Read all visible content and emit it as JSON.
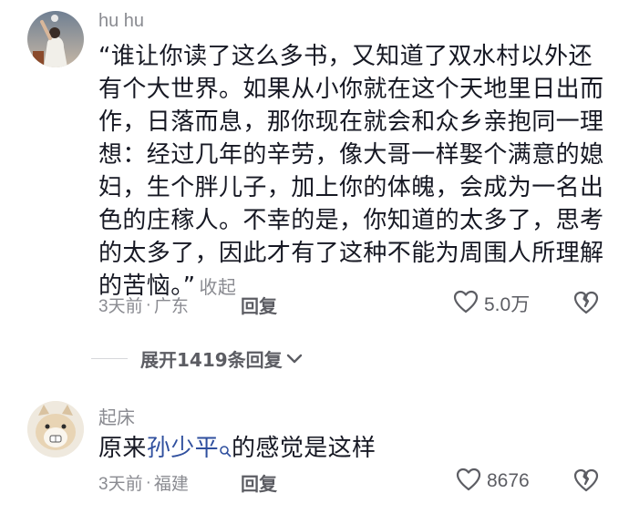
{
  "comment1": {
    "username": "hu hu",
    "text": "“谁让你读了这么多书，又知道了双水村以外还有个大世界。如果从小你就在这个天地里日出而作，日落而息，那你现在就会和众乡亲抱同一理想：经过几年的辛劳，像大哥一样娶个满意的媳妇，生个胖儿子，加上你的体魄，会成为一名出色的庄稼人。不幸的是，你知道的太多了，思考的太多了，因此才有了这种不能为周围人所理解的苦恼。”",
    "fold_label": "收起",
    "time": "3天前",
    "separator": "·",
    "location": "广东",
    "reply_label": "回复",
    "likes": "5.0万"
  },
  "expand": {
    "label": "展开1419条回复"
  },
  "comment2": {
    "username": "起床",
    "text_before": "原来",
    "mention": "孙少平",
    "text_after": "的感觉是这样",
    "time": "3天前",
    "separator": "·",
    "location": "福建",
    "reply_label": "回复",
    "likes": "8676"
  },
  "colors": {
    "meta_gray": "#8a8b91",
    "mention_blue": "#2f4f9e",
    "text": "#161823"
  }
}
